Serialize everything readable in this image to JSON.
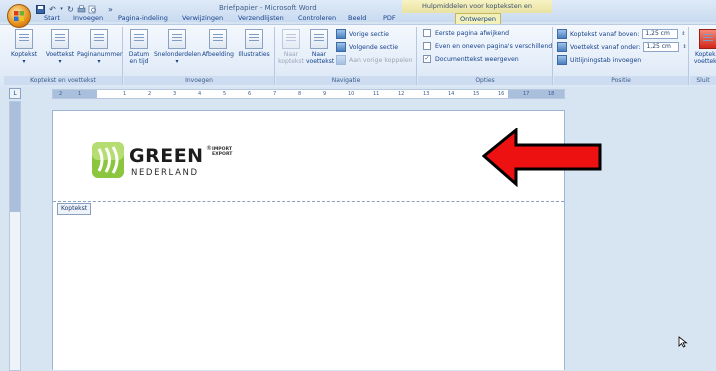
{
  "window": {
    "title": "Briefpapier - Microsoft Word",
    "context_tab_title": "Hulpmiddelen voor kopteksten en voetteksten"
  },
  "qat": {
    "save_icon": "save-icon",
    "undo_icon": "undo-icon",
    "redo_icon": "redo-icon",
    "print_icon": "print-icon",
    "more_label": "»"
  },
  "tabs": [
    {
      "label": "Start"
    },
    {
      "label": "Invoegen"
    },
    {
      "label": "Pagina-indeling"
    },
    {
      "label": "Verwijzingen"
    },
    {
      "label": "Verzendlijsten"
    },
    {
      "label": "Controleren"
    },
    {
      "label": "Beeld"
    },
    {
      "label": "PDF"
    },
    {
      "label": "Ontwerpen"
    }
  ],
  "ribbon": {
    "groups": {
      "header_footer": {
        "label": "Koptekst en voettekst",
        "buttons": [
          "Koptekst",
          "Voettekst",
          "Paginanummer"
        ]
      },
      "insert": {
        "label": "Invoegen",
        "buttons": [
          "Datum en tijd",
          "Snelonderdelen",
          "Afbeelding",
          "Illustraties"
        ]
      },
      "navigation": {
        "label": "Navigatie",
        "buttons": [
          "Naar koptekst",
          "Naar voettekst"
        ],
        "small": [
          "Vorige sectie",
          "Volgende sectie",
          "Aan vorige koppelen"
        ]
      },
      "options": {
        "label": "Opties",
        "items": [
          {
            "label": "Eerste pagina afwijkend",
            "checked": false
          },
          {
            "label": "Even en oneven pagina's verschillend",
            "checked": false
          },
          {
            "label": "Documenttekst weergeven",
            "checked": true
          }
        ]
      },
      "position": {
        "label": "Positie",
        "rows": [
          {
            "label": "Koptekst vanaf boven:",
            "value": "1,25 cm"
          },
          {
            "label": "Voettekst vanaf onder:",
            "value": "1,25 cm"
          },
          {
            "label": "Uitlijningstab invoegen"
          }
        ]
      },
      "close": {
        "label": "Sluit",
        "button": "Koptekst voettekst"
      }
    }
  },
  "ruler": {
    "ticks": [
      "2",
      "1",
      "1",
      "2",
      "3",
      "4",
      "5",
      "6",
      "7",
      "8",
      "9",
      "10",
      "11",
      "12",
      "13",
      "14",
      "15",
      "16",
      "17",
      "18"
    ]
  },
  "document": {
    "header_tag": "Koptekst",
    "logo": {
      "word": "GREEN",
      "reg": "®",
      "tag1": "IMPORT",
      "tag2": "EXPORT",
      "sub": "NEDERLAND"
    }
  },
  "colors": {
    "arrow": "#ee1111",
    "accent": "#15428b",
    "logo_green": "#8cc63f"
  }
}
